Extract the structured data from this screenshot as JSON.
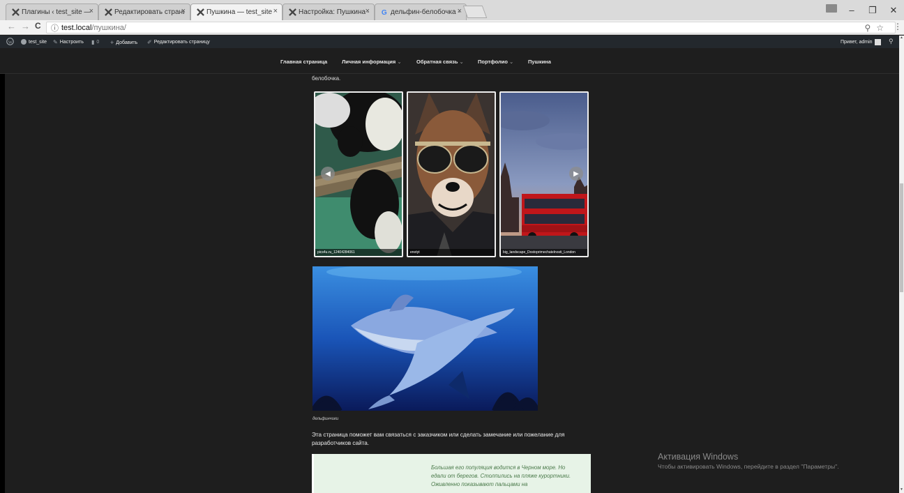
{
  "browser": {
    "tabs": [
      {
        "title": "Плагины ‹ test_site — W",
        "icon": "wp-icon",
        "active": false
      },
      {
        "title": "Редактировать страниц",
        "icon": "wp-icon",
        "active": false
      },
      {
        "title": "Пушкина — test_site",
        "icon": "wp-icon",
        "active": true
      },
      {
        "title": "Настройка: Пушкина —",
        "icon": "wp-icon",
        "active": false
      },
      {
        "title": "дельфин-белобочка - Г",
        "icon": "google-icon",
        "active": false
      }
    ],
    "close_glyph": "×",
    "window_controls": {
      "minimize": "–",
      "restore": "❐",
      "close": "✕"
    },
    "address": {
      "host": "test.local",
      "path": "/пушкина/"
    },
    "nav": {
      "back": "←",
      "forward": "→",
      "reload": "C",
      "info": "ⓘ"
    },
    "omni_icons": {
      "zoom": "⚲",
      "star": "☆",
      "menu": "⋮"
    }
  },
  "adminbar": {
    "site_name": "test_site",
    "customize": "Настроить",
    "comments_count": "0",
    "add_new": "Добавить",
    "edit_page": "Редактировать страницу",
    "greeting": "Привет, admin"
  },
  "site_nav": {
    "items": [
      {
        "label": "Главная страница",
        "has_submenu": false
      },
      {
        "label": "Личная информация",
        "has_submenu": true
      },
      {
        "label": "Обратная связь",
        "has_submenu": true
      },
      {
        "label": "Портфолио",
        "has_submenu": true
      },
      {
        "label": "Пушкина",
        "has_submenu": false
      }
    ],
    "submenu_glyph": "⌄"
  },
  "content": {
    "lead_text": "белобочка.",
    "gallery": [
      {
        "caption": "pics4u.ru_12404284061"
      },
      {
        "caption": "enotyt"
      },
      {
        "caption": "big_landscape_Dostoprimechatelnosti_London"
      }
    ],
    "slider": {
      "prev": "◀",
      "next": "▶"
    },
    "image_caption": "дельфинчики",
    "paragraph": "Эта страница поможет вам связаться с заказчиком или сделать замечание или пожелание для разработчиков сайта.",
    "quote": "Большая его популяция водится в Черном море. Но едали от берегов. Столпились на пляже курортники. Оживленно показывают пальцами на"
  },
  "windows_activation": {
    "title": "Активация Windows",
    "subtitle": "Чтобы активировать Windows, перейдите в раздел \"Параметры\"."
  },
  "scrollbar": {
    "up": "▲",
    "down": "▼"
  },
  "colors": {
    "wp_admin_bar": "#23282d",
    "page_bg": "#1e1e1e",
    "quote_bg": "#e7f3e7",
    "quote_text": "#4a7a4a"
  }
}
